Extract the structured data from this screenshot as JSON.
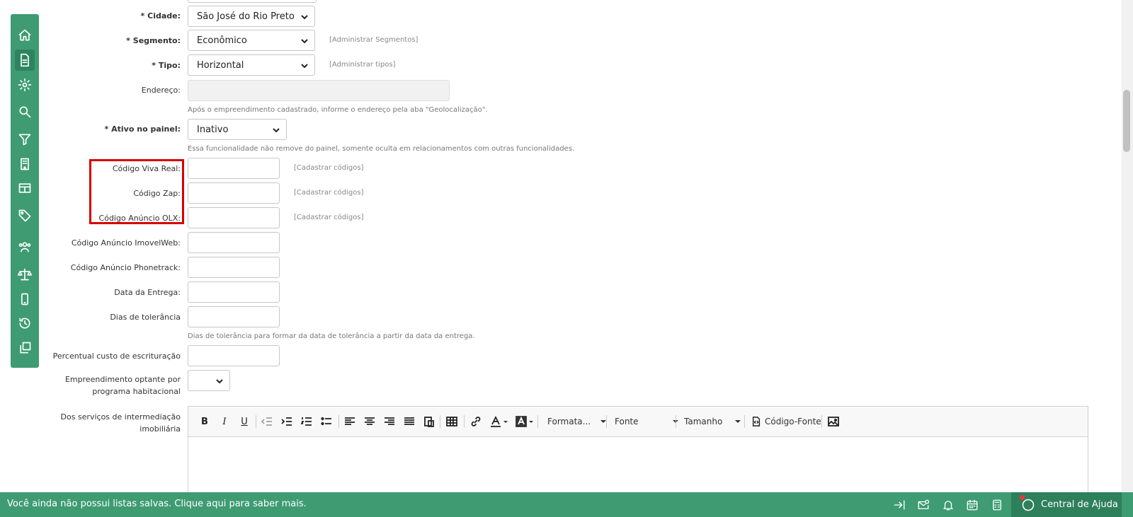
{
  "sidebar": {
    "items": [
      {
        "icon": "home-icon"
      },
      {
        "icon": "document-icon",
        "active": true
      },
      {
        "icon": "gear-icon"
      },
      {
        "icon": "search-icon"
      },
      {
        "icon": "filter-icon"
      },
      {
        "icon": "building-icon"
      },
      {
        "icon": "table-icon"
      },
      {
        "icon": "tag-icon"
      },
      {
        "icon": "users-icon"
      },
      {
        "icon": "scale-icon"
      },
      {
        "icon": "mobile-icon"
      },
      {
        "icon": "history-icon"
      },
      {
        "icon": "copy-icon"
      }
    ]
  },
  "form": {
    "cidade": {
      "label": "Cidade:",
      "value": "São José do Rio Preto"
    },
    "segmento": {
      "label": "Segmento:",
      "value": "Econômico",
      "link": "[Administrar Segmentos]"
    },
    "tipo": {
      "label": "Tipo:",
      "value": "Horizontal",
      "link": "[Administrar tipos]"
    },
    "endereco": {
      "label": "Endereço:",
      "hint": "Após o empreendimento cadastrado, informe o endereço pela aba \"Geolocalização\"."
    },
    "ativo": {
      "label": "Ativo no painel:",
      "value": "Inativo",
      "hint": "Essa funcionalidade não remove do painel, somente oculta em relacionamentos com outras funcionalidades."
    },
    "viva_real": {
      "label": "Código Viva Real:",
      "link": "[Cadastrar códigos]"
    },
    "zap": {
      "label": "Código Zap:",
      "link": "[Cadastrar códigos]"
    },
    "olx": {
      "label": "Código Anúncio OLX:",
      "link": "[Cadastrar códigos]"
    },
    "imovelweb": {
      "label": "Código Anúncio ImovelWeb:"
    },
    "phonetrack": {
      "label": "Código Anúncio Phonetrack:"
    },
    "entrega": {
      "label": "Data da Entrega:"
    },
    "tolerancia": {
      "label": "Dias de tolerância",
      "hint": "Dias de tolerância para formar da data de tolerância a partir da data da entrega."
    },
    "escrituracao": {
      "label": "Percentual custo de escrituração"
    },
    "habitacional": {
      "label": "Empreendimento optante por programa habitacional"
    },
    "servicos": {
      "label": "Dos serviços de intermediação imobiliária"
    }
  },
  "editor": {
    "bold": "B",
    "italic": "I",
    "underline": "U",
    "format": "Formata...",
    "font": "Fonte",
    "size": "Tamanho",
    "source": "Código-Fonte"
  },
  "footer": {
    "message": "Você ainda não possui listas salvas. Clique aqui para saber mais.",
    "help": "Central de Ajuda"
  },
  "colors": {
    "brand": "#3e9b72",
    "highlight": "#d60000"
  }
}
